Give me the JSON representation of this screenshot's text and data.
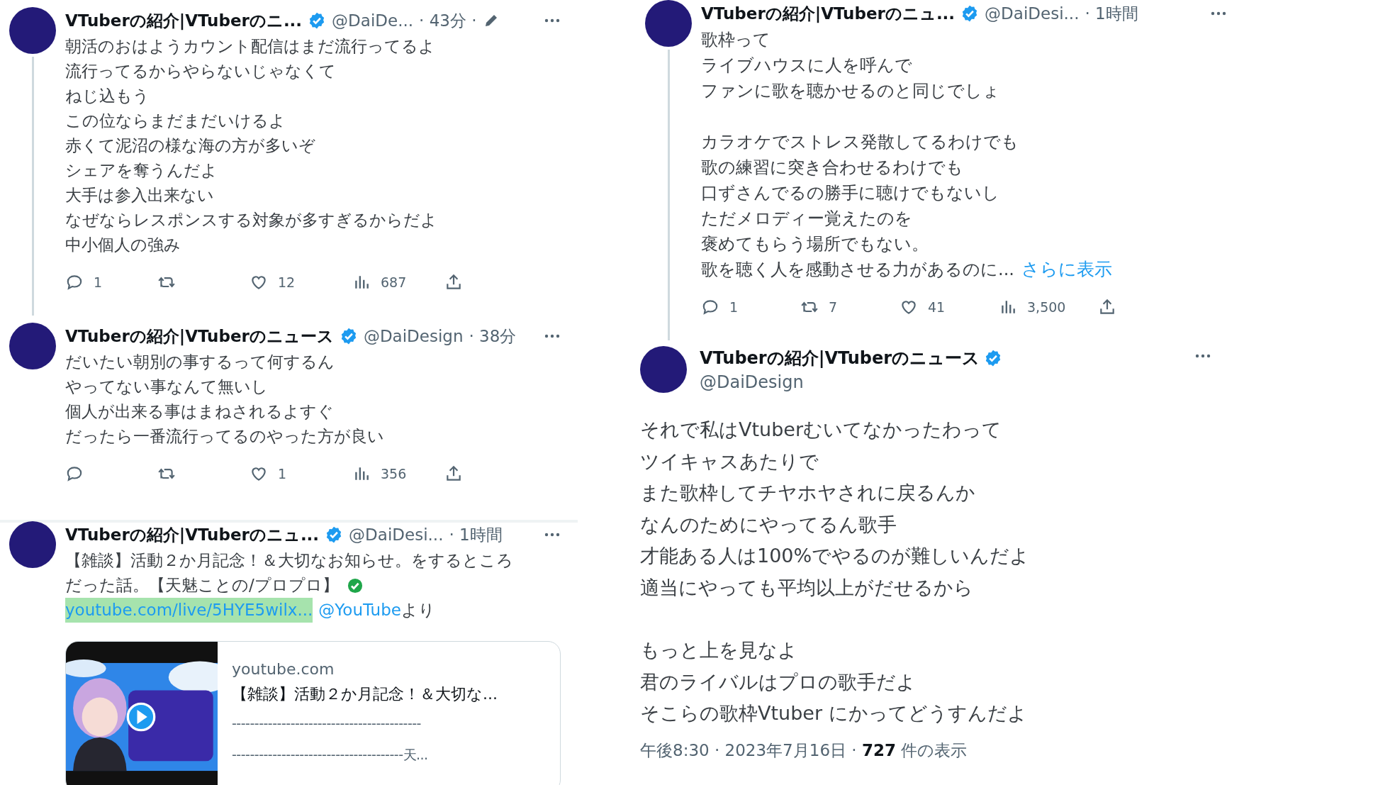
{
  "columns": [
    {
      "tweets": [
        {
          "kind": "thread",
          "thread_line": true,
          "display_name": "VTuberの紹介|VTuberのニ...",
          "verified": true,
          "handle": "@DaiDe...",
          "time": "· 43分 ·",
          "edited": true,
          "paragraphs": [
            [
              "朝活のおはようカウント配信はまだ流行ってるよ",
              "流行ってるからやらないじゃなくて",
              "ねじ込もう",
              "この位ならまだまだいけるよ",
              "赤くて泥沼の様な海の方が多いぞ",
              "シェアを奪うんだよ",
              "大手は参入出来ない",
              "なぜならレスポンスする対象が多すぎるからだよ",
              "中小個人の強み"
            ]
          ],
          "actions": {
            "replies": "1",
            "likes": "12",
            "views": "687"
          }
        },
        {
          "kind": "thread",
          "thread_line": false,
          "display_name": "VTuberの紹介|VTuberのニュース",
          "verified": true,
          "handle": "@DaiDesign",
          "time": "· 38分",
          "edited": false,
          "paragraphs": [
            [
              "だいたい朝別の事するって何するん",
              "やってない事なんて無いし",
              "個人が出来る事はまねされるよすぐ",
              "だったら一番流行ってるのやった方が良い"
            ]
          ],
          "actions": {
            "likes": "1",
            "views": "356"
          },
          "divider_after": true
        },
        {
          "kind": "link",
          "thread_line": false,
          "display_name": "VTuberの紹介|VTuberのニュ...",
          "verified": true,
          "handle": "@DaiDesi...",
          "time": "· 1時間",
          "edited": false,
          "paragraphs": [
            [
              "【雑談】活動２か月記念！＆大切なお知らせ。をするところ",
              "だった話。【天魅ことの/プロプロ】"
            ]
          ],
          "link": {
            "url": "youtube.com/live/5HYE5wilx...",
            "highlighted": true,
            "mention": "@YouTube",
            "suffix": "より"
          },
          "card": {
            "domain": "youtube.com",
            "title": "【雑談】活動２か月記念！＆大切な...",
            "description": [
              "------------------------------------------",
              "--------------------------------------天..."
            ]
          }
        }
      ]
    },
    {
      "tweets": [
        {
          "kind": "thread",
          "thread_line": true,
          "display_name": "VTuberの紹介|VTuberのニュ...",
          "verified": true,
          "handle": "@DaiDesi...",
          "time": "· 1時間",
          "edited": false,
          "paragraphs": [
            [
              "歌枠って",
              "ライブハウスに人を呼んで",
              "ファンに歌を聴かせるのと同じでしょ"
            ],
            [
              "カラオケでストレス発散してるわけでも",
              "歌の練習に突き合わせるわけでも",
              "口ずさんでるの勝手に聴けでもないし",
              "ただメロディー覚えたのを",
              "褒めてもらう場所でもない。",
              "歌を聴く人を感動させる力があるのに..."
            ]
          ],
          "show_more": "さらに表示",
          "actions": {
            "replies": "1",
            "retweets": "7",
            "likes": "41",
            "views": "3,500"
          }
        },
        {
          "kind": "focused",
          "display_name": "VTuberの紹介|VTuberのニュース",
          "verified": true,
          "handle": "@DaiDesign",
          "paragraphs": [
            [
              "それで私はVtuberむいてなかったわって",
              "ツイキャスあたりで",
              "また歌枠してチヤホヤされに戻るんか",
              "なんのためにやってるん歌手",
              "才能ある人は100%でやるのが難しいんだよ",
              "適当にやっても平均以上がだせるから"
            ],
            [
              "もっと上を見なよ",
              "君のライバルはプロの歌手だよ",
              "そこらの歌枠Vtuber にかってどうすんだよ"
            ]
          ],
          "footer": "午後8:30 · 2023年7月16日 · **727** 件の表示"
        }
      ]
    }
  ]
}
